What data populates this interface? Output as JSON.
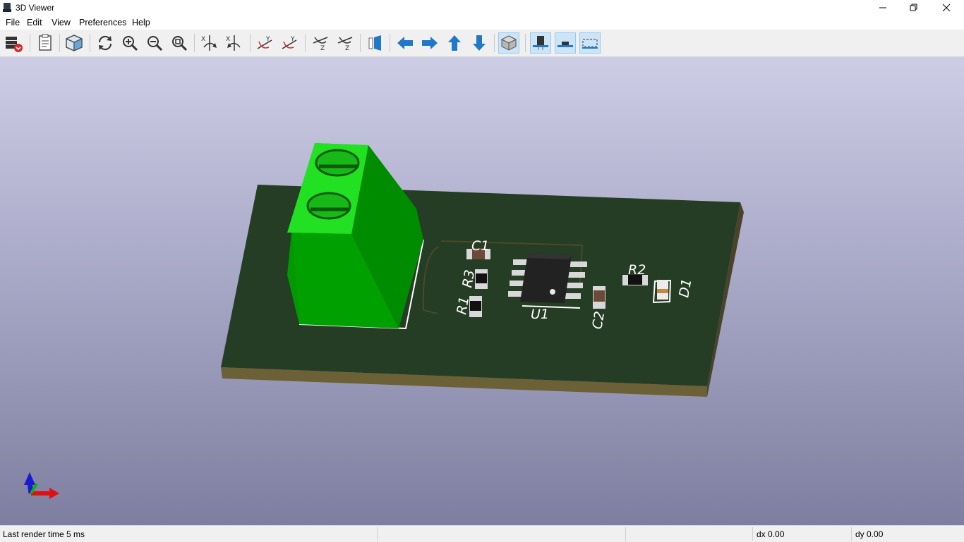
{
  "window": {
    "title": "3D Viewer"
  },
  "menu": [
    "File",
    "Edit",
    "View",
    "Preferences",
    "Help"
  ],
  "toolbar": {
    "icons": [
      "reload-board-icon",
      "copy-to-clipboard-icon",
      "view-3d-icon",
      "redraw-icon",
      "zoom-in-icon",
      "zoom-out-icon",
      "zoom-fit-icon",
      "rotate-x-cw-icon",
      "rotate-x-ccw-icon",
      "rotate-y-cw-icon",
      "rotate-y-ccw-icon",
      "rotate-z-cw-icon",
      "rotate-z-ccw-icon",
      "flip-board-icon",
      "move-left-icon",
      "move-right-icon",
      "move-up-icon",
      "move-down-icon",
      "orthographic-icon",
      "show-through-hole-icon",
      "show-smd-icon",
      "show-virtual-icon"
    ],
    "active": [
      "orthographic-icon",
      "show-through-hole-icon",
      "show-smd-icon",
      "show-virtual-icon"
    ]
  },
  "scene": {
    "refs": {
      "c1": "C1",
      "r3": "R3",
      "r1": "R1",
      "u1": "U1",
      "c2": "C2",
      "r2": "R2",
      "d1": "D1"
    },
    "colors": {
      "board": "#253c25",
      "board_edge": "#6b6036",
      "terminal_light": "#22e022",
      "terminal_mid": "#00b400",
      "terminal_dark": "#008c00"
    }
  },
  "status": {
    "render": "Last render time 5 ms",
    "dx": "dx 0.00",
    "dy": "dy 0.00"
  }
}
